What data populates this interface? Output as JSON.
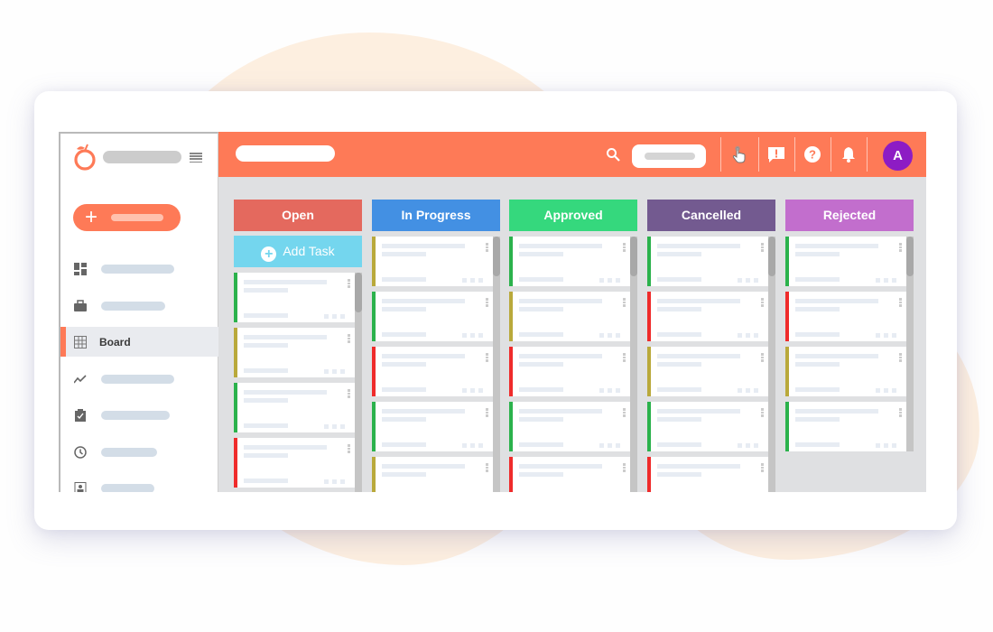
{
  "app": {
    "brand_colors": {
      "accent": "#fe7a57",
      "avatar": "#8d1cc4",
      "add_task": "#74d6ee"
    }
  },
  "sidebar": {
    "logo_icon": "orange-fruit-logo",
    "menu_icon": "hamburger-icon",
    "new_button_icon": "plus-icon",
    "items": [
      {
        "icon": "dashboard-icon",
        "label": "",
        "active": false
      },
      {
        "icon": "briefcase-icon",
        "label": "",
        "active": false
      },
      {
        "icon": "grid-icon",
        "label": "Board",
        "active": true
      },
      {
        "icon": "trend-icon",
        "label": "",
        "active": false
      },
      {
        "icon": "clipboard-check-icon",
        "label": "",
        "active": false
      },
      {
        "icon": "clock-icon",
        "label": "",
        "active": false
      },
      {
        "icon": "contact-card-icon",
        "label": "",
        "active": false
      }
    ]
  },
  "topbar": {
    "icons": [
      "search-icon",
      "hand-pointer-icon",
      "feedback-icon",
      "help-icon",
      "bell-icon"
    ],
    "avatar_initial": "A"
  },
  "board": {
    "add_task_label": "Add Task",
    "columns": [
      {
        "title": "Open",
        "color": "#e4695e",
        "cards": [
          "green",
          "olive",
          "green",
          "red"
        ]
      },
      {
        "title": "In Progress",
        "color": "#4390e3",
        "cards": [
          "olive",
          "green",
          "red",
          "green",
          "olive"
        ]
      },
      {
        "title": "Approved",
        "color": "#35d87d",
        "cards": [
          "green",
          "olive",
          "red",
          "green",
          "red"
        ]
      },
      {
        "title": "Cancelled",
        "color": "#735a90",
        "cards": [
          "green",
          "red",
          "olive",
          "green",
          "red"
        ]
      },
      {
        "title": "Rejected",
        "color": "#c26ecd",
        "cards": [
          "green",
          "red",
          "olive",
          "green"
        ]
      }
    ],
    "priority_colors": {
      "green": "#2bb24c",
      "olive": "#b9a93b",
      "red": "#ef2b2b"
    }
  }
}
